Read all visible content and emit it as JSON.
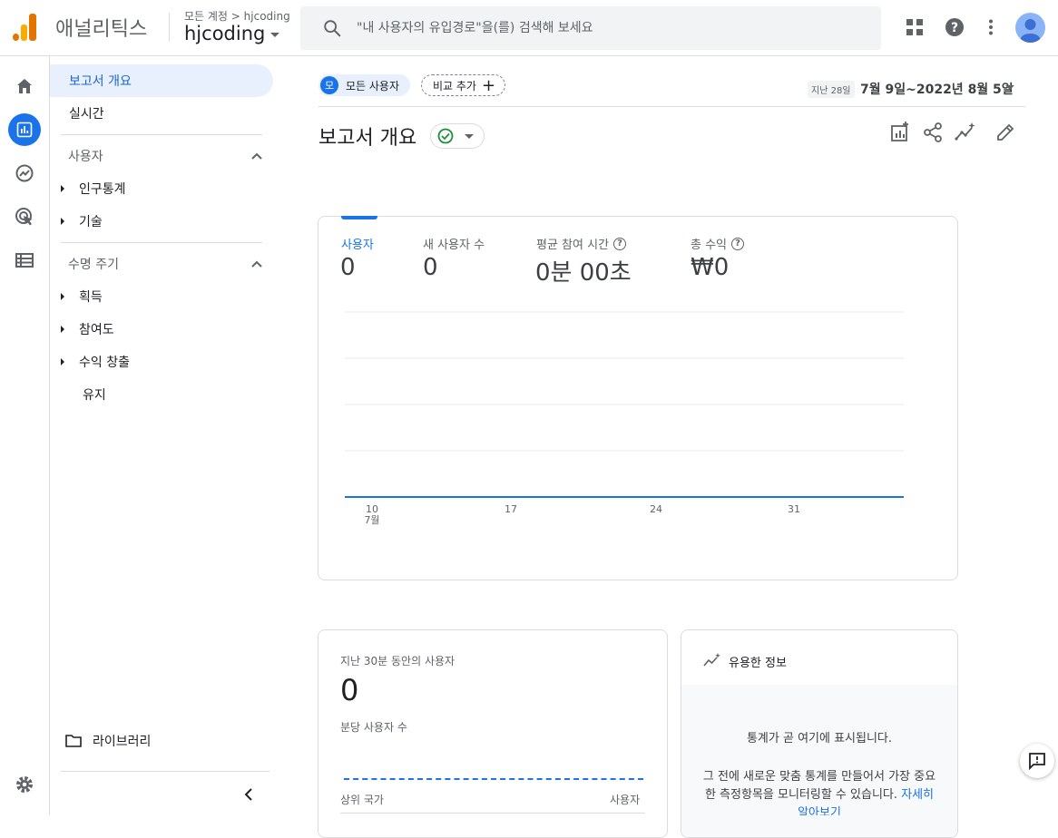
{
  "topbar": {
    "product_name": "애널리틱스",
    "breadcrumb": "모든 계정 > hjcoding",
    "property": "hjcoding",
    "search_placeholder": "\"내 사용자의 유입경로\"을(를) 검색해 보세요",
    "icons": [
      "apps-icon",
      "help-icon",
      "more-vert-icon",
      "account-avatar"
    ]
  },
  "rail": {
    "icons": [
      "home-icon",
      "reports-icon",
      "explore-icon",
      "advertising-icon",
      "configure-icon",
      "settings-icon"
    ],
    "active": "reports-icon"
  },
  "nav": {
    "overview": "보고서 개요",
    "realtime": "실시간",
    "section_user": "사용자",
    "user_items": [
      "인구통계",
      "기술"
    ],
    "section_lifecycle": "수명 주기",
    "lifecycle_items": [
      "획득",
      "참여도",
      "수익 창출"
    ],
    "retention": "유지",
    "library": "라이브러리"
  },
  "header": {
    "segment_badge": "모",
    "segment_label": "모든 사용자",
    "add_comparison": "비교 추가",
    "date_prefix": "지난 28일",
    "date_range": "7월 9일~2022년 8월 5일",
    "title": "보고서 개요",
    "actions": [
      "customize-report-icon",
      "share-icon",
      "insights-icon",
      "edit-icon"
    ]
  },
  "metrics": [
    {
      "label": "사용자",
      "value": "0",
      "selected": true
    },
    {
      "label": "새 사용자 수",
      "value": "0",
      "selected": false
    },
    {
      "label": "평균 참여 시간",
      "value": "0분 00초",
      "selected": false,
      "help": true
    },
    {
      "label": "총 수익",
      "value": "₩0",
      "selected": false,
      "help": true
    }
  ],
  "chart_data": {
    "type": "line",
    "x": [
      "10",
      "17",
      "24",
      "31"
    ],
    "x_sublabel": "7월",
    "series": [
      {
        "values": [
          0,
          0,
          0,
          0
        ]
      }
    ],
    "grid": true,
    "line_color": "#1a73e8"
  },
  "realtime_card": {
    "title": "지난 30분 동안의 사용자",
    "value": "0",
    "per_minute": "분당 사용자 수",
    "col_country": "상위 국가",
    "col_users": "사용자"
  },
  "insights_card": {
    "title": "유용한 정보",
    "line1": "통계가 곧 여기에 표시됩니다.",
    "line2": "그 전에 새로운 맞춤 통계를 만들어서 가장 중요한 측정항목을 모니터링할 수 있습니다.",
    "link": "자세히 알아보기"
  }
}
